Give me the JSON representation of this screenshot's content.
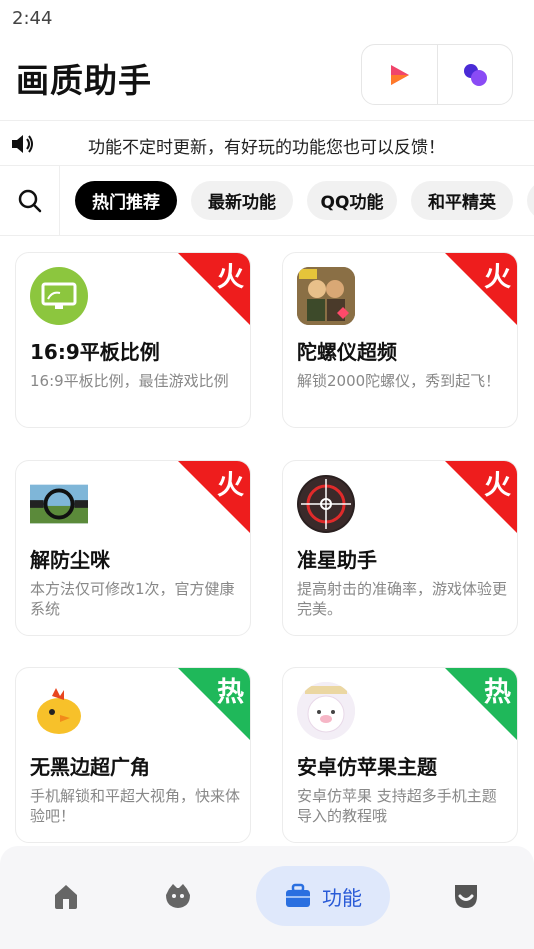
{
  "status_bar": {
    "time": "2:44"
  },
  "header": {
    "title": "画质助手",
    "actions": [
      {
        "icon": "play-icon",
        "color": "#f0456a"
      },
      {
        "icon": "bubbles-icon",
        "color": "#6a3ff0"
      }
    ]
  },
  "notice": {
    "icon": "speaker-icon",
    "text": "功能不定时更新，有好玩的功能您也可以反馈！"
  },
  "tabs": [
    {
      "label": "热门推荐",
      "active": true
    },
    {
      "label": "最新功能",
      "active": false
    },
    {
      "label": "QQ功能",
      "active": false
    },
    {
      "label": "和平精英",
      "active": false
    }
  ],
  "cards": [
    {
      "title": "16:9平板比例",
      "desc": "16:9平板比例，最佳游戏比例",
      "badge": "火",
      "badge_color": "#ee1d1d",
      "icon": "tablet-icon"
    },
    {
      "title": "陀螺仪超频",
      "desc": "解锁2000陀螺仪，秀到起飞！",
      "badge": "火",
      "badge_color": "#ee1d1d",
      "icon": "game-character-icon"
    },
    {
      "title": "解防尘咪",
      "desc": "本方法仅可修改1次，官方健康系统",
      "badge": "火",
      "badge_color": "#ee1d1d",
      "icon": "scope-view-icon"
    },
    {
      "title": "准星助手",
      "desc": "提高射击的准确率，游戏体验更完美。",
      "badge": "火",
      "badge_color": "#ee1d1d",
      "icon": "crosshair-icon"
    },
    {
      "title": "无黑边超广角",
      "desc": "手机解锁和平超大视角，快来体验吧！",
      "badge": "热",
      "badge_color": "#1fb85a",
      "icon": "chick-icon"
    },
    {
      "title": "安卓仿苹果主题",
      "desc": "安卓仿苹果 支持超多手机主题导入的教程哦",
      "badge": "热",
      "badge_color": "#1fb85a",
      "icon": "cute-pig-icon"
    }
  ],
  "bottom_nav": [
    {
      "icon": "home-icon",
      "label": ""
    },
    {
      "icon": "pet-icon",
      "label": ""
    },
    {
      "icon": "briefcase-icon",
      "label": "功能",
      "active": true
    },
    {
      "icon": "profile-icon",
      "label": ""
    }
  ]
}
